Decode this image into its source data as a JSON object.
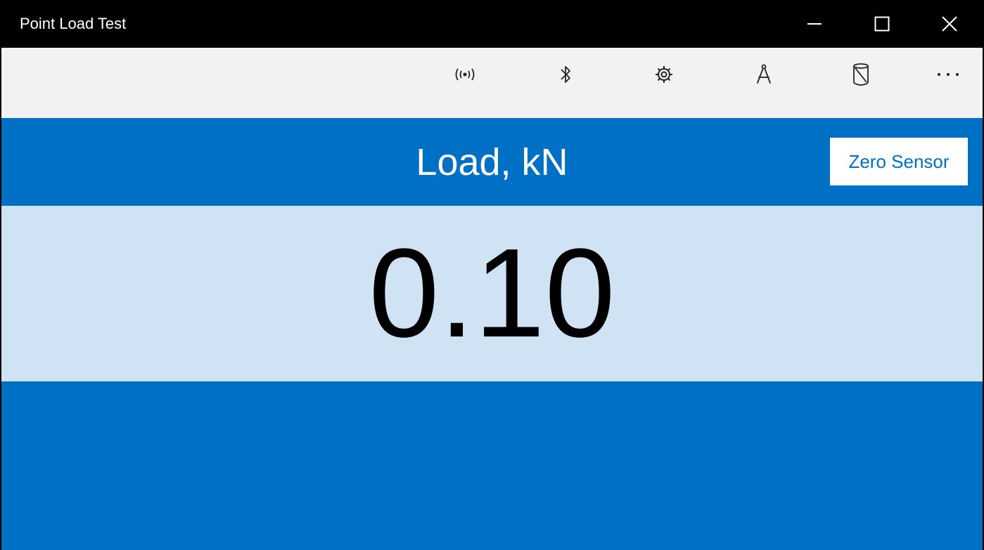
{
  "window": {
    "title": "Point Load Test"
  },
  "caption_buttons": {
    "icons": [
      "minimize-icon",
      "maximize-icon",
      "close-icon"
    ]
  },
  "command_bar": {
    "icons": [
      "broadcast-icon",
      "bluetooth-icon",
      "gear-icon",
      "compass-icon",
      "cylinder-icon",
      "more-icon"
    ]
  },
  "header": {
    "label": "Load, kN",
    "zero_button": "Zero Sensor"
  },
  "reading": {
    "value": "0.10"
  },
  "colors": {
    "accent": "#0070C5",
    "panel": "#CFE3F4",
    "command_bar": "#F2F2F2",
    "title_bar": "#000000"
  }
}
